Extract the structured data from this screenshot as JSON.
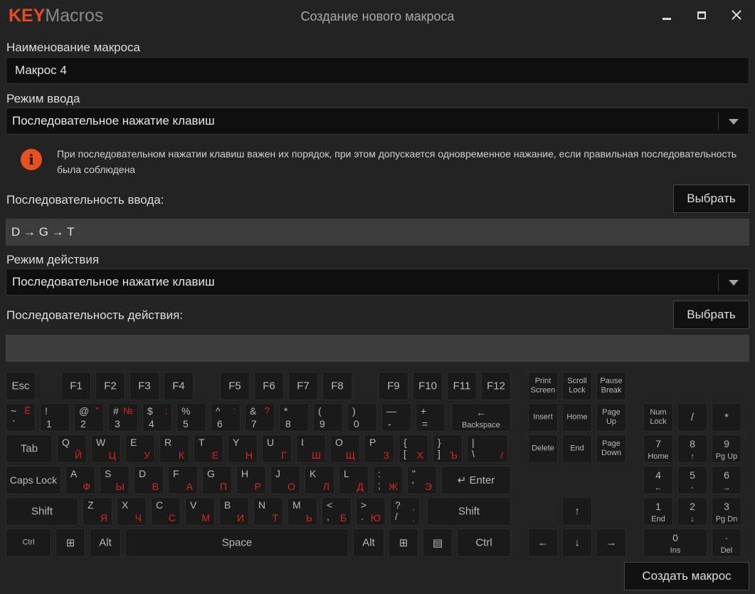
{
  "app": {
    "logo_bold": "KEY",
    "logo_light": "Macros",
    "window_title": "Создание нового макроса"
  },
  "form": {
    "name_label": "Наименование макроса",
    "name_value": "Макрос 4",
    "input_mode_label": "Режим ввода",
    "input_mode_value": "Последовательное нажатие клавиш",
    "info_text": "При последовательном нажатии клавиш важен их порядок, при этом допускается одновременное нажание, если правильная последовательность была соблюдена",
    "input_seq_label": "Последовательность ввода:",
    "input_seq_value": "D → G → T",
    "select_button": "Выбрать",
    "action_mode_label": "Режим действия",
    "action_mode_value": "Последовательное нажатие клавиш",
    "action_seq_label": "Последовательность действия:",
    "action_seq_value": "",
    "create_button": "Создать макрос"
  },
  "keyboard": {
    "fn_row": [
      "Esc",
      "F1",
      "F2",
      "F3",
      "F4",
      "F5",
      "F6",
      "F7",
      "F8",
      "F9",
      "F10",
      "F11",
      "F12"
    ],
    "nav_top": [
      "Print\nScreen",
      "Scroll\nLock",
      "Pause\nBreak"
    ],
    "num_row": [
      {
        "t": "~",
        "b": "`",
        "r": "Ё"
      },
      {
        "t": "!",
        "b": "1",
        "r": ""
      },
      {
        "t": "@",
        "b": "2",
        "r": "\""
      },
      {
        "t": "#",
        "b": "3",
        "r": "№"
      },
      {
        "t": "$",
        "b": "4",
        "r": ";"
      },
      {
        "t": "%",
        "b": "5",
        "r": ""
      },
      {
        "t": "^",
        "b": "6",
        "r": ":"
      },
      {
        "t": "&",
        "b": "7",
        "r": "?"
      },
      {
        "t": "*",
        "b": "8",
        "r": ""
      },
      {
        "t": "(",
        "b": "9",
        "r": ""
      },
      {
        "t": ")",
        "b": "0",
        "r": ""
      },
      {
        "t": "—",
        "b": "-",
        "r": ""
      },
      {
        "t": "+",
        "b": "=",
        "r": ""
      }
    ],
    "backspace": {
      "arrow": "←",
      "label": "Backspace"
    },
    "tab": "Tab",
    "q_row": [
      {
        "l": "Q",
        "r": "Й"
      },
      {
        "l": "W",
        "r": "Ц"
      },
      {
        "l": "E",
        "r": "У"
      },
      {
        "l": "R",
        "r": "К"
      },
      {
        "l": "T",
        "r": "Е"
      },
      {
        "l": "Y",
        "r": "Н"
      },
      {
        "l": "U",
        "r": "Г"
      },
      {
        "l": "I",
        "r": "Ш"
      },
      {
        "l": "O",
        "r": "Щ"
      },
      {
        "l": "P",
        "r": "З"
      },
      {
        "l": "{\n[",
        "r": "Х"
      },
      {
        "l": "}\n]",
        "r": "Ъ"
      },
      {
        "l": "|\n\\",
        "r": "/"
      }
    ],
    "caps": "Caps Lock",
    "a_row": [
      {
        "l": "A",
        "r": "Ф"
      },
      {
        "l": "S",
        "r": "Ы"
      },
      {
        "l": "D",
        "r": "В"
      },
      {
        "l": "F",
        "r": "А"
      },
      {
        "l": "G",
        "r": "П"
      },
      {
        "l": "H",
        "r": "Р"
      },
      {
        "l": "J",
        "r": "О"
      },
      {
        "l": "K",
        "r": "Л"
      },
      {
        "l": "L",
        "r": "Д"
      },
      {
        "l": ":\n;",
        "r": "Ж"
      },
      {
        "l": "\"\n'",
        "r": "Э"
      }
    ],
    "enter": "↵ Enter",
    "shift": "Shift",
    "z_row": [
      {
        "l": "Z",
        "r": "Я"
      },
      {
        "l": "X",
        "r": "Ч"
      },
      {
        "l": "C",
        "r": "С"
      },
      {
        "l": "V",
        "r": "М"
      },
      {
        "l": "B",
        "r": "И"
      },
      {
        "l": "N",
        "r": "Т"
      },
      {
        "l": "M",
        "r": "Ь"
      },
      {
        "l": "<\n,",
        "r": "Б"
      },
      {
        "l": ">\n.",
        "r": "Ю"
      },
      {
        "l": "?\n/",
        "r": ",\n."
      }
    ],
    "ctrl": "Ctrl",
    "alt": "Alt",
    "space": "Space",
    "nav_mid": [
      "Insert",
      "Home",
      "Page\nUp",
      "Delete",
      "End",
      "Page\nDown"
    ],
    "arrows": {
      "up": "↑",
      "left": "←",
      "down": "↓",
      "right": "→"
    },
    "numpad": {
      "numlock": "Num\nLock",
      "div": "/",
      "mul": "*",
      "n7": {
        "t": "7",
        "b": "Home"
      },
      "n8": {
        "t": "8",
        "b": "↑"
      },
      "n9": {
        "t": "9",
        "b": "Pg Up"
      },
      "n4": {
        "t": "4",
        "b": "←"
      },
      "n5": {
        "t": "5",
        "b": "-"
      },
      "n6": {
        "t": "6",
        "b": "→"
      },
      "n1": {
        "t": "1",
        "b": "End"
      },
      "n2": {
        "t": "2",
        "b": "↓"
      },
      "n3": {
        "t": "3",
        "b": "Pg Dn"
      },
      "n0": {
        "t": "0",
        "b": "Ins"
      },
      "ndot": {
        "t": "·",
        "b": "Del"
      }
    }
  }
}
